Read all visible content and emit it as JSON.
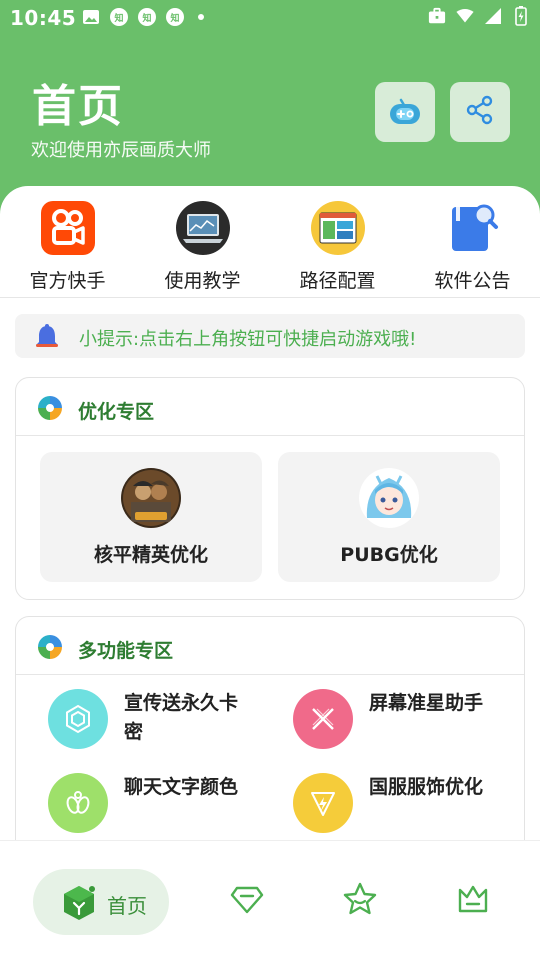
{
  "status_bar": {
    "time": "10:45",
    "notif_zhi_1": "知",
    "notif_zhi_2": "知",
    "notif_zhi_3": "知"
  },
  "header": {
    "title": "首页",
    "subtitle": "欢迎使用亦辰画质大师"
  },
  "quick_actions": [
    {
      "label": "官方快手",
      "icon": "kuaishou-icon"
    },
    {
      "label": "使用教学",
      "icon": "laptop-icon"
    },
    {
      "label": "路径配置",
      "icon": "layout-icon"
    },
    {
      "label": "软件公告",
      "icon": "search-doc-icon"
    }
  ],
  "tip": {
    "text": "小提示:点击右上角按钮可快捷启动游戏哦!"
  },
  "optimize_section": {
    "title": "优化专区",
    "items": [
      {
        "label": "核平精英优化"
      },
      {
        "label": "PUBG优化"
      }
    ]
  },
  "multi_section": {
    "title": "多功能专区",
    "items": [
      {
        "label": "宣传送永久卡密",
        "color": "#6ee0e0"
      },
      {
        "label": "屏幕准星助手",
        "color": "#f06a8a"
      },
      {
        "label": "聊天文字颜色",
        "color": "#9ee06a"
      },
      {
        "label": "国服服饰优化",
        "color": "#f5cc3a"
      }
    ]
  },
  "bottom_nav": {
    "home_label": "首页"
  },
  "colors": {
    "primary": "#6abf6a",
    "accent_text": "#4caf50",
    "section_title": "#2e7d32"
  }
}
